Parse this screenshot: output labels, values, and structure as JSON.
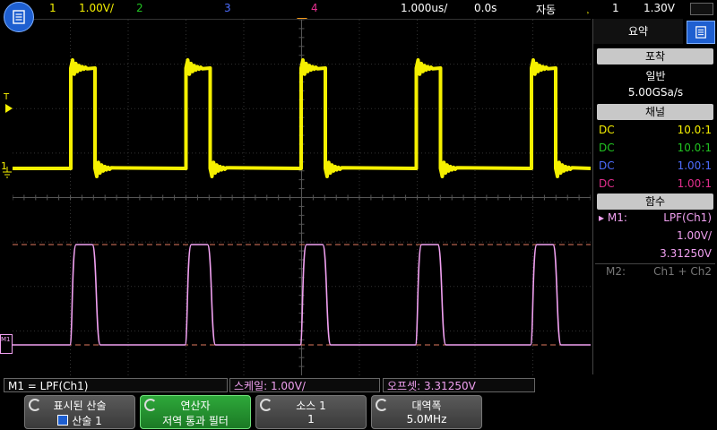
{
  "topbar": {
    "ch1_num": "1",
    "ch1_scale": "1.00V/",
    "ch2_num": "2",
    "ch3_num": "3",
    "ch4_num": "4",
    "timebase": "1.000us/",
    "delay": "0.0s",
    "trigger_mode": "자동",
    "trigger_source": "1",
    "trigger_level": "1.30V"
  },
  "colors": {
    "ch1": "#f5f000",
    "ch2": "#22c422",
    "ch3": "#4d6dff",
    "ch4": "#e52f8f",
    "math": "#f0a0f0",
    "accent": "#1e5fd0"
  },
  "side": {
    "tab_label": "요약",
    "acq_header": "포착",
    "acq_mode": "일반",
    "acq_rate": "5.00GSa/s",
    "channel_header": "채널",
    "channels": [
      {
        "coupling": "DC",
        "probe": "10.0:1"
      },
      {
        "coupling": "DC",
        "probe": "10.0:1"
      },
      {
        "coupling": "DC",
        "probe": "1.00:1"
      },
      {
        "coupling": "DC",
        "probe": "1.00:1"
      }
    ],
    "func_header": "함수",
    "m1_label": "▸ M1:",
    "m1_func": "LPF(Ch1)",
    "m1_scale": "1.00V/",
    "m1_offset": "3.31250V",
    "m2_label": "M2:",
    "m2_func": "Ch1 + Ch2"
  },
  "markers": {
    "ch1": "1",
    "math": "M1",
    "trigger_level": "T"
  },
  "status": {
    "math_def": "M1 = LPF(Ch1)",
    "scale": "스케일: 1.00V/",
    "offset": "오프셋: 3.31250V"
  },
  "softkeys": [
    {
      "line1": "표시된 산술",
      "line2": "산술 1"
    },
    {
      "line1": "연산자",
      "line2": "저역 통과 필터"
    },
    {
      "line1": "소스 1",
      "line2": "1"
    },
    {
      "line1": "대역폭",
      "line2": "5.0MHz"
    }
  ]
}
